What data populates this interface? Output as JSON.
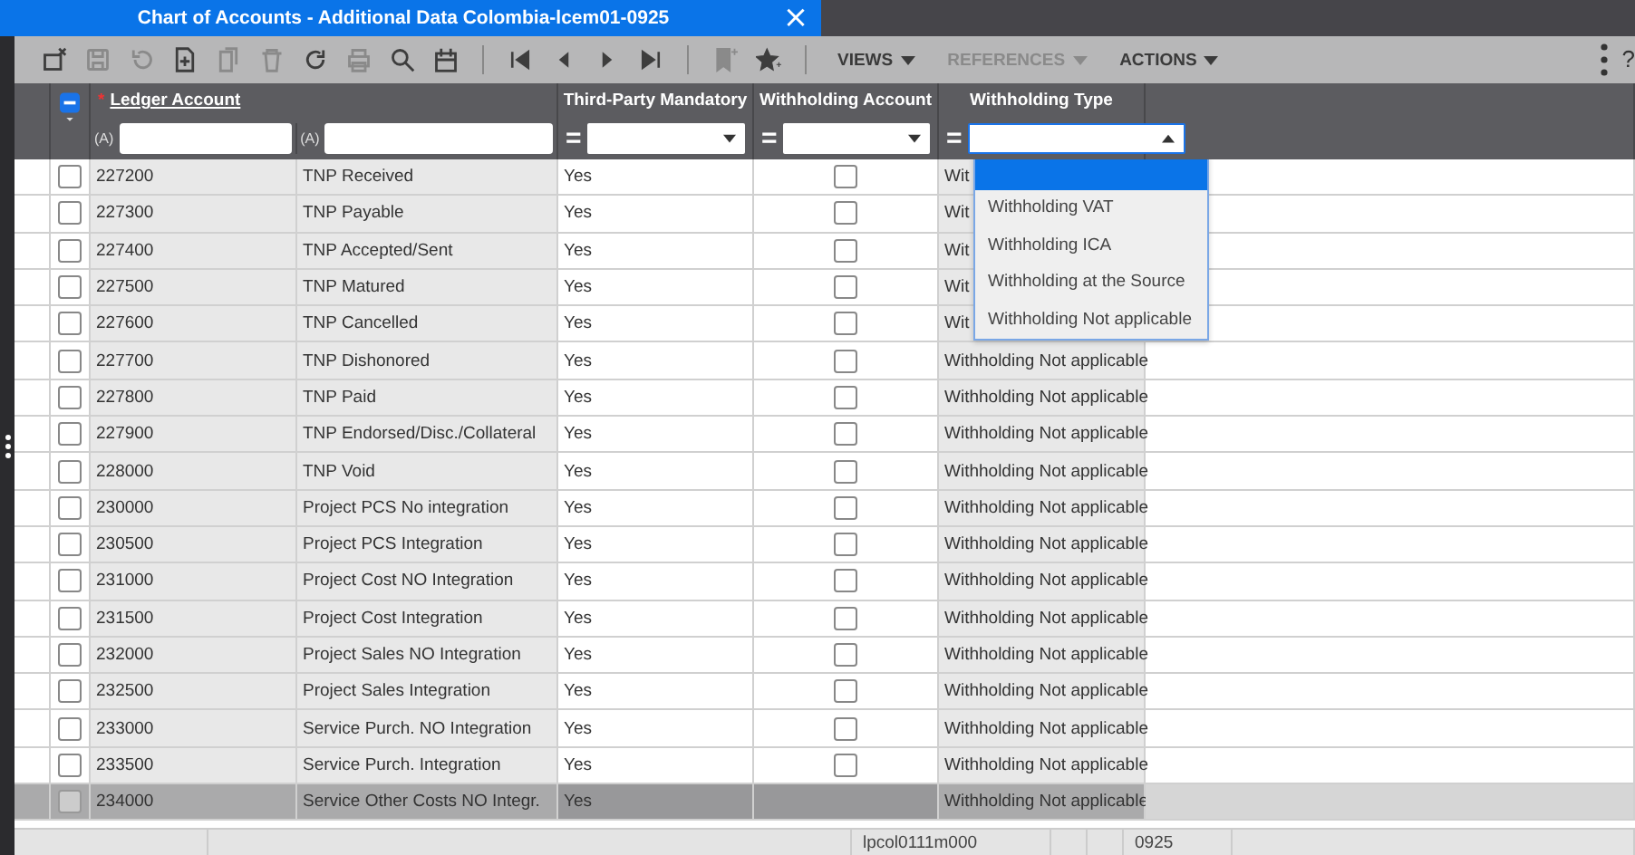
{
  "window": {
    "title": "Chart of Accounts - Additional Data Colombia-lcem01-0925",
    "close": "×"
  },
  "toolbar": {
    "menus": [
      {
        "label": "VIEWS",
        "disabled": false
      },
      {
        "label": "REFERENCES",
        "disabled": true
      },
      {
        "label": "ACTIONS",
        "disabled": false
      }
    ],
    "help": "?"
  },
  "table": {
    "select_all": {
      "checked": true
    },
    "columns": [
      {
        "label": "Ledger Account",
        "required": "*",
        "filter_prefix": "(A)"
      },
      {
        "filter_prefix": "(A)"
      },
      {
        "label": "Third-Party Mandatory",
        "operator": "="
      },
      {
        "label": "Withholding Account",
        "operator": "="
      },
      {
        "label": "Withholding Type",
        "operator": "="
      }
    ],
    "rows": [
      {
        "account": "227200",
        "description": "TNP Received",
        "third_party": "Yes",
        "withholding_account": false,
        "withholding_type": "Wit",
        "checked": false,
        "selected": false
      },
      {
        "account": "227300",
        "description": "TNP Payable",
        "third_party": "Yes",
        "withholding_account": false,
        "withholding_type": "Wit",
        "checked": false,
        "selected": false
      },
      {
        "account": "227400",
        "description": "TNP Accepted/Sent",
        "third_party": "Yes",
        "withholding_account": false,
        "withholding_type": "Wit",
        "checked": false,
        "selected": false
      },
      {
        "account": "227500",
        "description": "TNP Matured",
        "third_party": "Yes",
        "withholding_account": false,
        "withholding_type": "Wit",
        "checked": false,
        "selected": false
      },
      {
        "account": "227600",
        "description": "TNP Cancelled",
        "third_party": "Yes",
        "withholding_account": false,
        "withholding_type": "Wit",
        "checked": false,
        "selected": false
      },
      {
        "account": "227700",
        "description": "TNP Dishonored",
        "third_party": "Yes",
        "withholding_account": false,
        "withholding_type": "Withholding Not applicable",
        "checked": false,
        "selected": false
      },
      {
        "account": "227800",
        "description": "TNP Paid",
        "third_party": "Yes",
        "withholding_account": false,
        "withholding_type": "Withholding Not applicable",
        "checked": false,
        "selected": false
      },
      {
        "account": "227900",
        "description": "TNP Endorsed/Disc./Collateral",
        "third_party": "Yes",
        "withholding_account": false,
        "withholding_type": "Withholding Not applicable",
        "checked": false,
        "selected": false
      },
      {
        "account": "228000",
        "description": "TNP Void",
        "third_party": "Yes",
        "withholding_account": false,
        "withholding_type": "Withholding Not applicable",
        "checked": false,
        "selected": false
      },
      {
        "account": "230000",
        "description": "Project PCS No integration",
        "third_party": "Yes",
        "withholding_account": false,
        "withholding_type": "Withholding Not applicable",
        "checked": false,
        "selected": false
      },
      {
        "account": "230500",
        "description": "Project PCS Integration",
        "third_party": "Yes",
        "withholding_account": false,
        "withholding_type": "Withholding Not applicable",
        "checked": false,
        "selected": false
      },
      {
        "account": "231000",
        "description": "Project Cost NO Integration",
        "third_party": "Yes",
        "withholding_account": false,
        "withholding_type": "Withholding Not applicable",
        "checked": false,
        "selected": false
      },
      {
        "account": "231500",
        "description": "Project Cost Integration",
        "third_party": "Yes",
        "withholding_account": false,
        "withholding_type": "Withholding Not applicable",
        "checked": false,
        "selected": false
      },
      {
        "account": "232000",
        "description": "Project Sales NO Integration",
        "third_party": "Yes",
        "withholding_account": false,
        "withholding_type": "Withholding Not applicable",
        "checked": false,
        "selected": false
      },
      {
        "account": "232500",
        "description": "Project Sales Integration",
        "third_party": "Yes",
        "withholding_account": false,
        "withholding_type": "Withholding Not applicable",
        "checked": false,
        "selected": false
      },
      {
        "account": "233000",
        "description": "Service Purch. NO Integration",
        "third_party": "Yes",
        "withholding_account": false,
        "withholding_type": "Withholding Not applicable",
        "checked": false,
        "selected": false
      },
      {
        "account": "233500",
        "description": "Service Purch. Integration",
        "third_party": "Yes",
        "withholding_account": false,
        "withholding_type": "Withholding Not applicable",
        "checked": false,
        "selected": false
      },
      {
        "account": "234000",
        "description": "Service Other Costs NO Integr.",
        "third_party": "Yes",
        "withholding_type": "Withholding Not applicable",
        "checked": false,
        "selected": true
      }
    ]
  },
  "dropdown": {
    "options": [
      {
        "selected": true
      },
      {
        "label": "Withholding VAT",
        "selected": false
      },
      {
        "label": "Withholding ICA",
        "selected": false
      },
      {
        "label": "Withholding at the Source",
        "selected": false
      },
      {
        "label": "Withholding Not applicable",
        "selected": false
      }
    ]
  },
  "status_bar": {
    "session": "lpcol0111m000",
    "company": "0925"
  }
}
